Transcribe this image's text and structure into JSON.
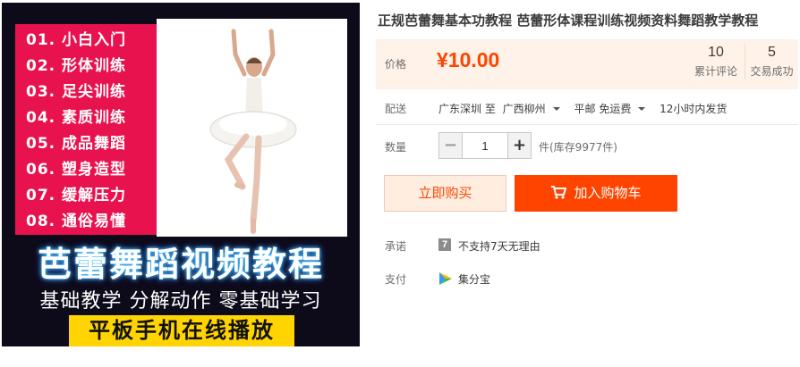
{
  "product_image": {
    "menu_items": [
      "01. 小白入门",
      "02. 形体训练",
      "03. 足尖训练",
      "04. 素质训练",
      "05. 成品舞蹈",
      "06. 塑身造型",
      "07. 缓解压力",
      "08. 通俗易懂"
    ],
    "headline": "芭蕾舞蹈视频教程",
    "subline": "基础教学 分解动作 零基础学习",
    "banner": "平板手机在线播放",
    "colors": {
      "menu_bg": "#e8124e",
      "banner_bg": "#ffd400",
      "background": "#0d0a1a"
    }
  },
  "product": {
    "title": "正规芭蕾舞基本功教程 芭蕾形体课程训练视频资料舞蹈教学教程"
  },
  "price": {
    "label": "价格",
    "value": "¥10.00",
    "reviews_count": "10",
    "reviews_label": "累计评论",
    "sales_count": "5",
    "sales_label": "交易成功",
    "color": "#ff4400"
  },
  "shipping": {
    "label": "配送",
    "from": "广东深圳 至",
    "to": "广西柳州",
    "method": "平邮 免运费",
    "dispatch": "12小时内发货"
  },
  "quantity": {
    "label": "数量",
    "value": "1",
    "minus": "−",
    "plus": "+",
    "stock": "件(库存9977件)"
  },
  "actions": {
    "buy_now": "立即购买",
    "add_to_cart": "加入购物车"
  },
  "promise": {
    "label": "承诺",
    "icon_text": "7",
    "text": "不支持7天无理由"
  },
  "payment": {
    "label": "支付",
    "text": "集分宝"
  }
}
